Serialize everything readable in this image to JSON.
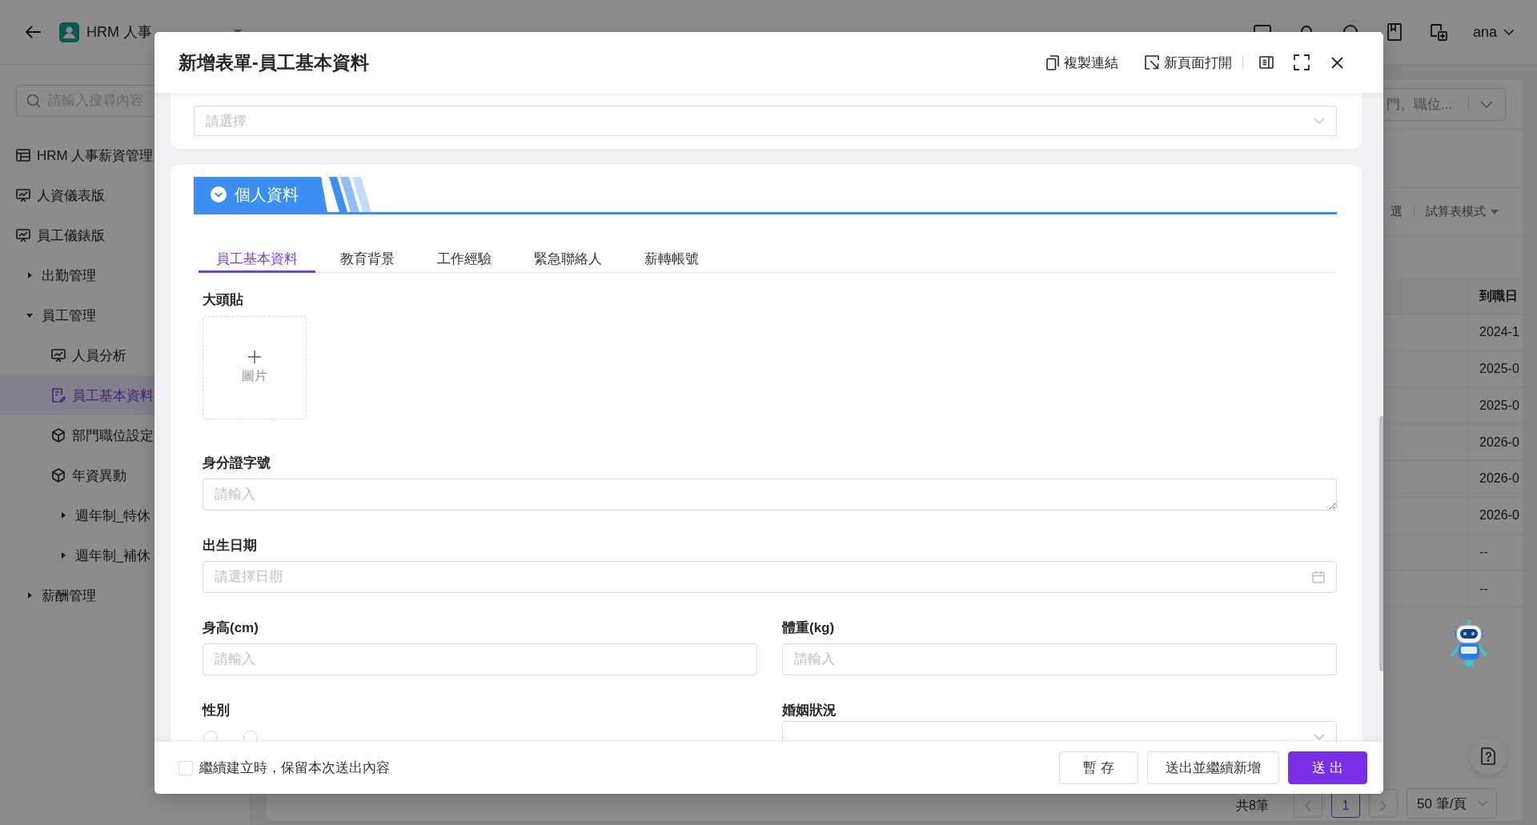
{
  "app_bar": {
    "title": "HRM 人事",
    "user": "ana"
  },
  "sidebar": {
    "search": {
      "placeholder": "請輸入搜尋內容"
    },
    "items": [
      {
        "label": "HRM 人事薪資管理",
        "kind": "app",
        "selected": false
      },
      {
        "label": "人資儀表版",
        "kind": "dashboard",
        "selected": false
      },
      {
        "label": "員工儀錶版",
        "kind": "dashboard",
        "selected": false
      },
      {
        "label": "出勤管理",
        "kind": "group",
        "expanded": false,
        "selected": false
      },
      {
        "label": "員工管理",
        "kind": "group",
        "expanded": true,
        "selected": false,
        "children": [
          {
            "label": "人員分析",
            "kind": "dashboard",
            "selected": false
          },
          {
            "label": "員工基本資料",
            "kind": "form",
            "selected": true
          },
          {
            "label": "部門職位設定",
            "kind": "module",
            "selected": false
          },
          {
            "label": "年資異動",
            "kind": "module",
            "selected": false
          },
          {
            "label": "週年制_特休",
            "kind": "group",
            "expanded": false,
            "selected": false
          },
          {
            "label": "週年制_補休",
            "kind": "group",
            "expanded": false,
            "selected": false
          }
        ]
      },
      {
        "label": "薪酬管理",
        "kind": "group",
        "expanded": false,
        "selected": false
      }
    ]
  },
  "content": {
    "filter": {
      "placeholder": "門、職位..."
    },
    "toolbar": [
      {
        "label": "選",
        "kind": "link"
      },
      {
        "label": "試算表模式",
        "kind": "dropdown"
      }
    ],
    "table": {
      "columns": [
        "到職日"
      ],
      "rows": [
        [
          "2024-1"
        ],
        [
          "2025-0"
        ],
        [
          "2025-0"
        ],
        [
          "2026-0"
        ],
        [
          "2026-0"
        ],
        [
          "2026-0"
        ],
        [
          "--"
        ],
        [
          "--"
        ]
      ]
    },
    "pagination": {
      "total": "共8筆",
      "pages": [
        {
          "label": "1",
          "selected": true
        }
      ],
      "page_size": "50 筆/頁"
    }
  },
  "modal": {
    "title": "新增表單-員工基本資料",
    "actions": [
      {
        "label": "複製連結",
        "kind": "copy"
      },
      {
        "label": "新頁面打開",
        "kind": "open"
      }
    ],
    "top_field": {
      "placeholder": "請選擇"
    },
    "section": {
      "title": "個人資料",
      "expanded": true
    },
    "tabs": [
      {
        "label": "員工基本資料",
        "selected": true
      },
      {
        "label": "教育背景",
        "selected": false
      },
      {
        "label": "工作經驗",
        "selected": false
      },
      {
        "label": "緊急聯絡人",
        "selected": false
      },
      {
        "label": "薪轉帳號",
        "selected": false
      }
    ],
    "rows": [
      [
        {
          "kind": "upload",
          "label": "大頭貼",
          "text": "圖片"
        }
      ],
      [
        {
          "kind": "textarea",
          "label": "身分證字號",
          "placeholder": "請輸入"
        }
      ],
      [
        {
          "kind": "date",
          "label": "出生日期",
          "placeholder": "請選擇日期"
        }
      ],
      [
        {
          "kind": "input",
          "label": "身高(cm)",
          "placeholder": "請輸入"
        },
        {
          "kind": "input",
          "label": "體重(kg)",
          "placeholder": "請輸入"
        }
      ],
      [
        {
          "kind": "radio",
          "label": "性別",
          "options": [
            {
              "selected": false
            },
            {
              "selected": false
            }
          ]
        },
        {
          "kind": "select",
          "label": "婚姻狀況"
        }
      ]
    ],
    "footer": {
      "keep": {
        "label": "繼續建立時，保留本次送出內容",
        "checked": false
      },
      "buttons": [
        {
          "label": "暫 存",
          "kind": "default"
        },
        {
          "label": "送出並繼續新增",
          "kind": "default"
        },
        {
          "label": "送 出",
          "kind": "primary"
        }
      ]
    }
  }
}
